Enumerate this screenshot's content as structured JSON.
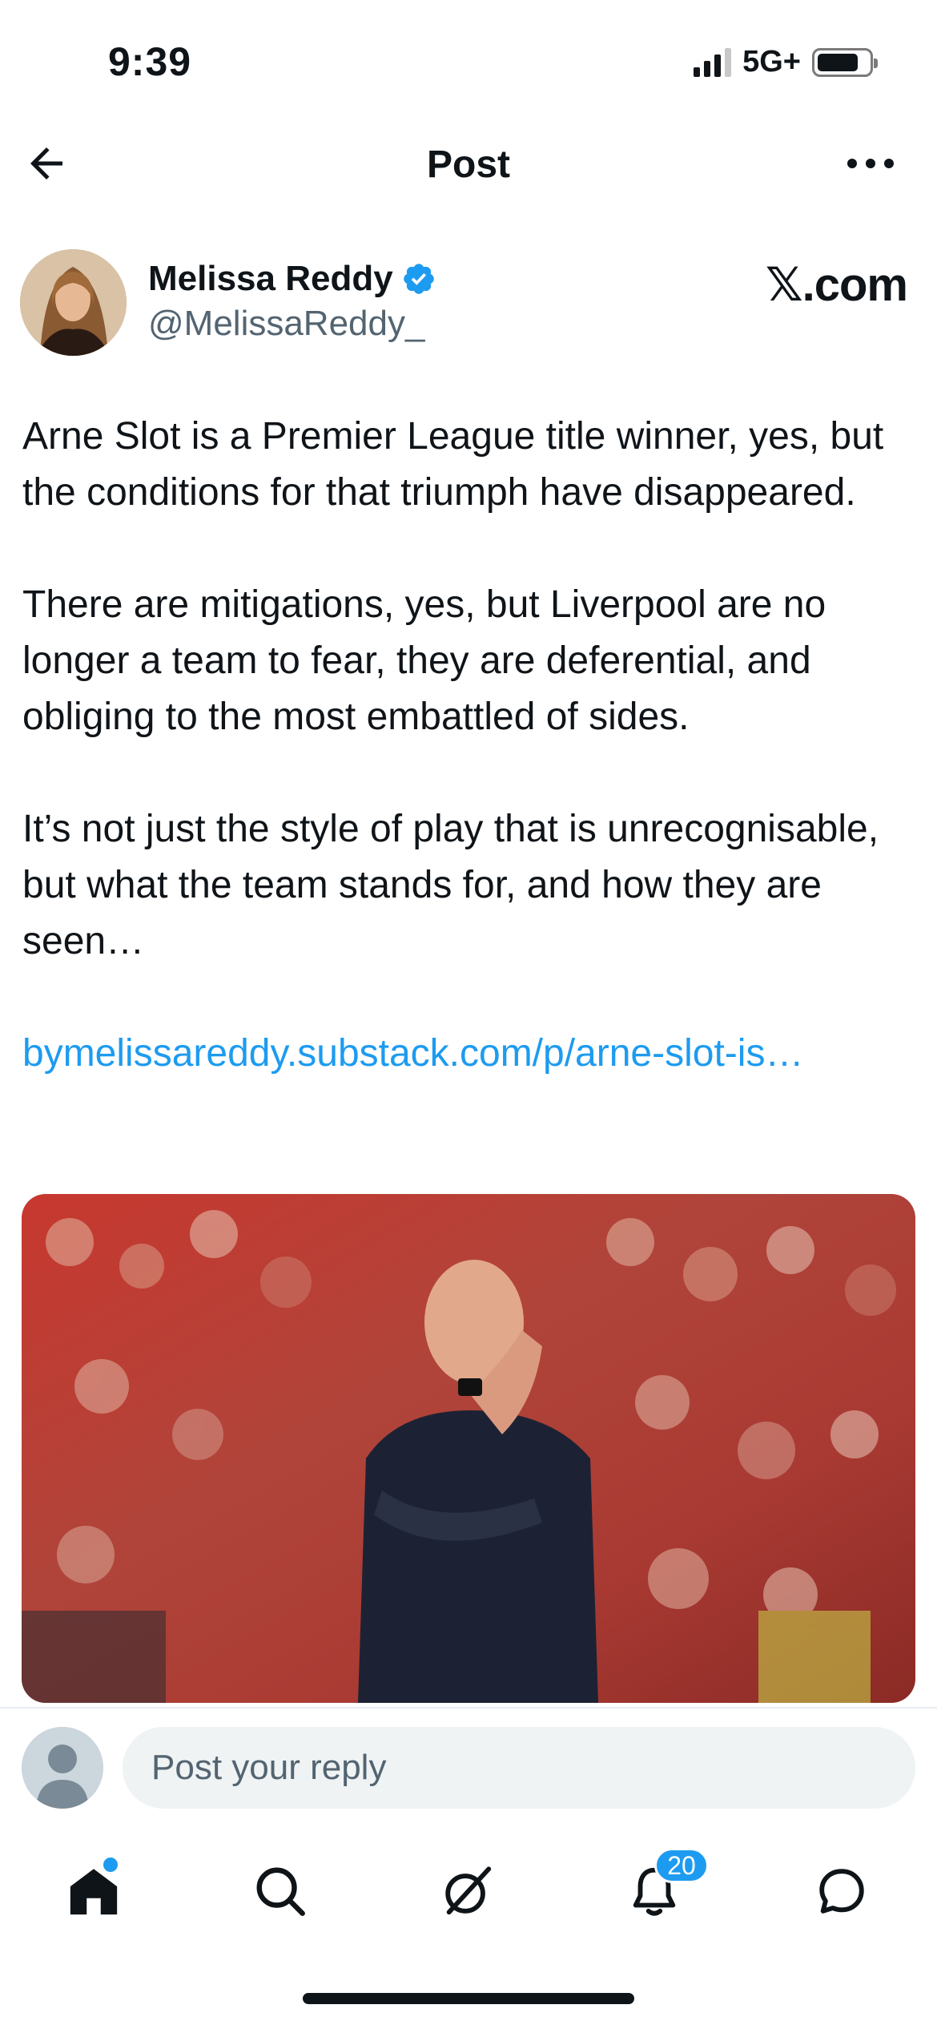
{
  "status_bar": {
    "time": "9:39",
    "network": "5G+",
    "battery_level": 0.8
  },
  "header": {
    "title": "Post",
    "back_icon": "arrow-left-icon",
    "more_icon": "more-horizontal-icon"
  },
  "author": {
    "name": "Melissa Reddy",
    "handle": "@MelissaReddy_",
    "verified": true,
    "source_logo": "𝕏.com"
  },
  "post": {
    "paragraphs": [
      "Arne Slot is a Premier League title winner, yes, but the conditions for that triumph have disappeared.",
      "There are mitigations, yes, but Liverpool are no longer a team to fear, they are deferential, and obliging to the most embattled of sides.",
      "It’s not just the style of play that is unrecognisable, but what the team stands for, and how they are seen…"
    ],
    "link_text": "bymelissareddy.substack.com/p/arne-slot-is…"
  },
  "reply": {
    "placeholder": "Post your reply"
  },
  "bottom_nav": {
    "items": [
      "home-icon",
      "search-icon",
      "grok-icon",
      "notifications-icon",
      "messages-icon"
    ],
    "notification_count": "20",
    "accent": "#1d9bf0"
  }
}
